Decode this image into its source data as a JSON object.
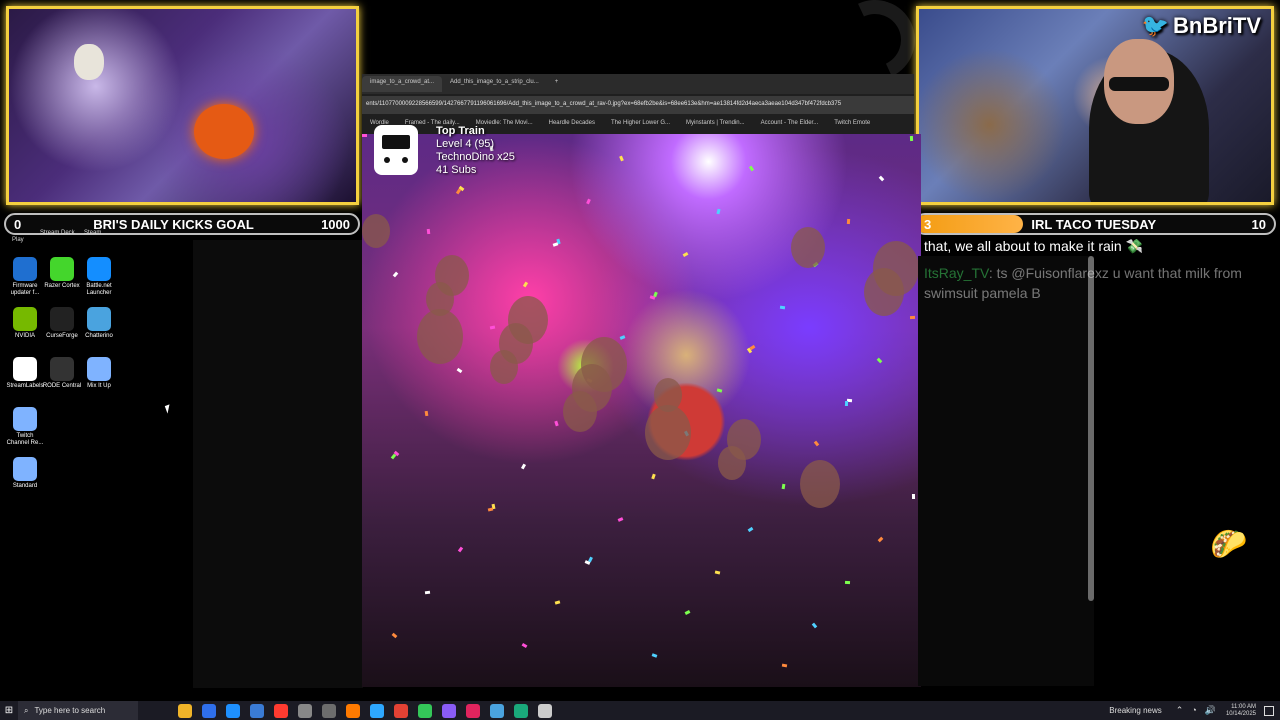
{
  "streamer": {
    "twitter_handle": "BnBriTV"
  },
  "goals": {
    "left": {
      "current": "0",
      "title": "BRI'S DAILY KICKS GOAL",
      "target": "1000",
      "progress": 0
    },
    "right": {
      "current": "3",
      "title": "IRL TACO TUESDAY",
      "target": "10",
      "progress": 0.3
    }
  },
  "desktop": {
    "top_labels": [
      "Play",
      "Stream Deck",
      "Steam"
    ],
    "icons": [
      {
        "label": "Firmware updater f...",
        "icon": "firmware-icon",
        "color": "#1f6fd0"
      },
      {
        "label": "Razer Cortex",
        "icon": "razer-icon",
        "color": "#44d62c"
      },
      {
        "label": "Battle.net Launcher",
        "icon": "battlenet-icon",
        "color": "#148eff"
      },
      {
        "label": "NVIDIA",
        "icon": "nvidia-icon",
        "color": "#76b900"
      },
      {
        "label": "CurseForge",
        "icon": "curseforge-icon",
        "color": "#222222"
      },
      {
        "label": "Chatterino",
        "icon": "chatterino-icon",
        "color": "#4aa3df"
      },
      {
        "label": "StreamLabels",
        "icon": "streamlabels-icon",
        "color": "#ffffff"
      },
      {
        "label": "RODE Central",
        "icon": "rode-icon",
        "color": "#333333"
      },
      {
        "label": "Mix It Up",
        "icon": "mixitup-icon",
        "color": "#7fb3ff"
      },
      {
        "label": "Twitch Channel Re...",
        "icon": "twitch-channel-icon",
        "color": "#7fb3ff"
      },
      {
        "label": "Standard",
        "icon": "standard-icon",
        "color": "#7fb3ff"
      }
    ]
  },
  "browser": {
    "tabs": [
      "image_to_a_crowd_at...",
      "Add_this_image_to_a_strip_clu..."
    ],
    "url": "ents/1107700009228566599/1427667791196061696/Add_this_image_to_a_crowd_at_rav-0.jpg?ex=68efb2be&is=68ee613e&hm=ae13814fd2d4aeca3aeae104d347bf472fdcb375",
    "bookmarks": [
      "Wordle",
      "Framed - The daily...",
      "Moviedle: The Movi...",
      "Heardle Decades",
      "The Higher Lower G...",
      "Myinstants | Trendin...",
      "Account - The Elder...",
      "Twitch Emote"
    ]
  },
  "train": {
    "title": "Top Train",
    "level": "Level 4  (95)",
    "top_user": "TechnoDino x25",
    "subs": "41 Subs"
  },
  "chat": {
    "line1": "that, we all about to make it rain",
    "line2_user": "ItsRay_TV",
    "line2_text": ": ts @Fuisonflarexz u want that milk from swimsuit pamela B"
  },
  "taskbar": {
    "search_placeholder": "Type here to search",
    "news": "Breaking news",
    "time": "11:00 AM",
    "date": "10/14/2025"
  },
  "colors": {
    "goal_fill": "#f39c12",
    "cam_border": "#f4d03f",
    "taskbar": "#1b1b24"
  }
}
